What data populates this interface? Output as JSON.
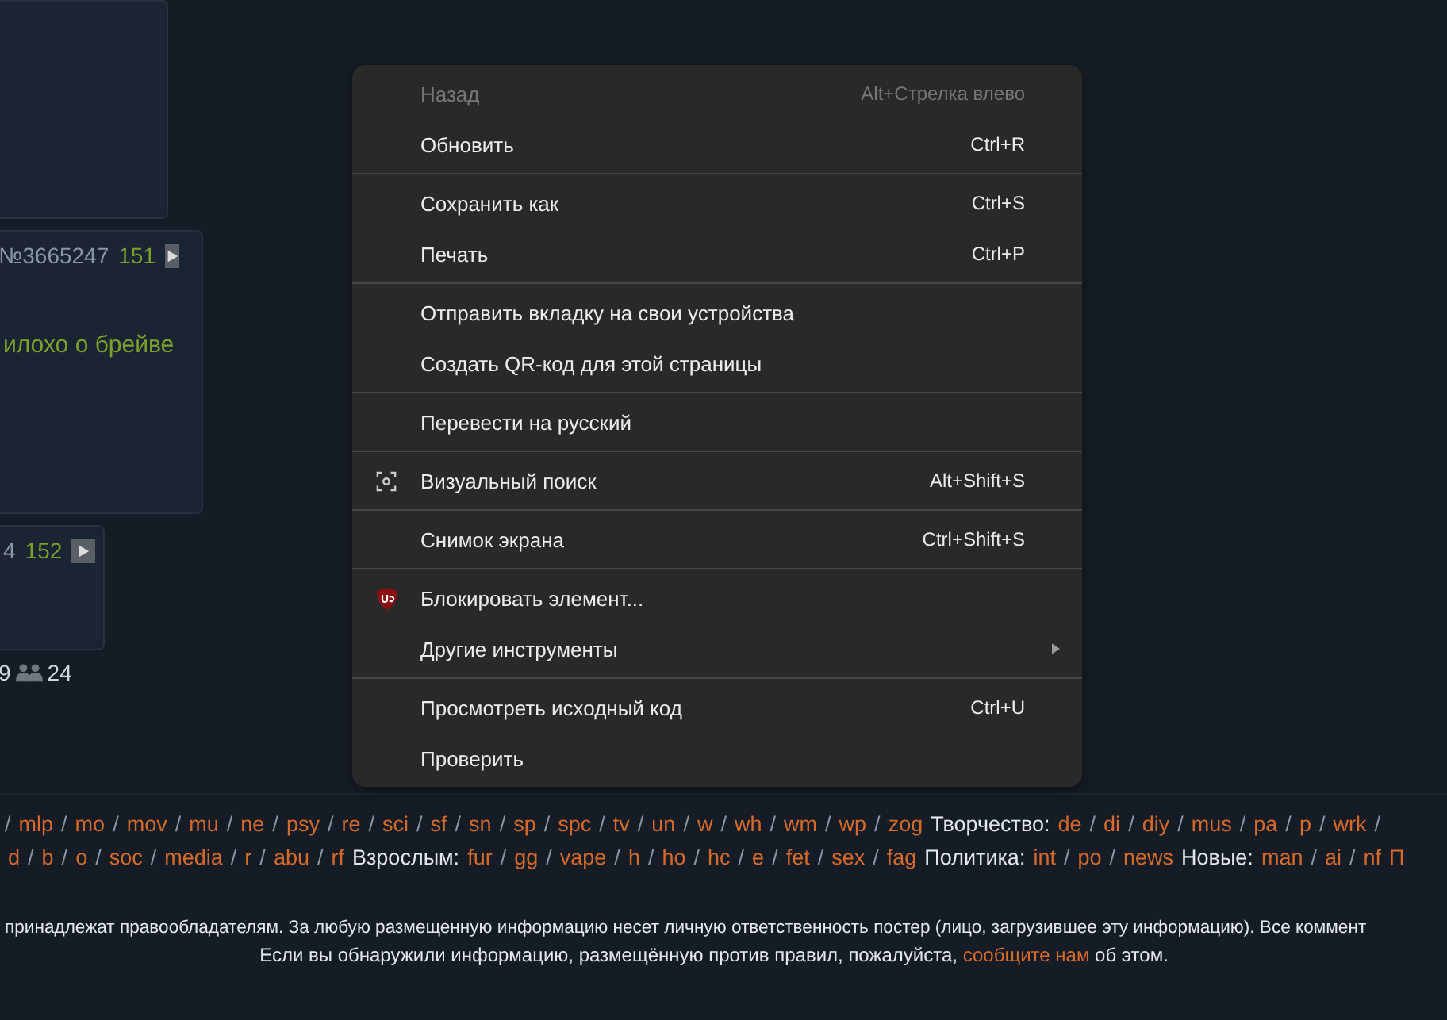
{
  "posts": [
    {
      "number": "№3665247",
      "count": "151",
      "text": "илохо о брейве"
    },
    {
      "number": "4",
      "count": "152"
    }
  ],
  "thread_stats": {
    "posts": "9",
    "users": "24"
  },
  "context_menu": {
    "sections": [
      [
        {
          "label": "Назад",
          "shortcut": "Alt+Стрелка влево",
          "kind": "plain",
          "disabled": true
        },
        {
          "label": "Обновить",
          "shortcut": "Ctrl+R",
          "kind": "plain",
          "disabled": false
        }
      ],
      [
        {
          "label": "Сохранить как",
          "shortcut": "Ctrl+S",
          "kind": "plain",
          "disabled": false
        },
        {
          "label": "Печать",
          "shortcut": "Ctrl+P",
          "kind": "plain",
          "disabled": false
        }
      ],
      [
        {
          "label": "Отправить вкладку на свои устройства",
          "kind": "plain",
          "disabled": false
        },
        {
          "label": "Создать QR-код для этой страницы",
          "kind": "plain",
          "disabled": false
        }
      ],
      [
        {
          "label": "Перевести на русский",
          "kind": "plain",
          "disabled": false
        }
      ],
      [
        {
          "label": "Визуальный поиск",
          "shortcut": "Alt+Shift+S",
          "kind": "lens",
          "disabled": false
        }
      ],
      [
        {
          "label": "Снимок экрана",
          "shortcut": "Ctrl+Shift+S",
          "kind": "plain",
          "disabled": false
        }
      ],
      [
        {
          "label": "Блокировать элемент...",
          "kind": "shield",
          "disabled": false
        },
        {
          "label": "Другие инструменты",
          "kind": "submenu",
          "disabled": false
        }
      ],
      [
        {
          "label": "Просмотреть исходный код",
          "shortcut": "Ctrl+U",
          "kind": "plain",
          "disabled": false
        },
        {
          "label": "Проверить",
          "kind": "plain",
          "disabled": false
        }
      ]
    ]
  },
  "board_links": [
    [
      {
        "kind": "sep",
        "text": "/"
      },
      {
        "kind": "link",
        "text": "mlp"
      },
      {
        "kind": "sep",
        "text": "/"
      },
      {
        "kind": "link",
        "text": "mo"
      },
      {
        "kind": "sep",
        "text": "/"
      },
      {
        "kind": "link",
        "text": "mov"
      },
      {
        "kind": "sep",
        "text": "/"
      },
      {
        "kind": "link",
        "text": "mu"
      },
      {
        "kind": "sep",
        "text": "/"
      },
      {
        "kind": "link",
        "text": "ne"
      },
      {
        "kind": "sep",
        "text": "/"
      },
      {
        "kind": "link",
        "text": "psy"
      },
      {
        "kind": "sep",
        "text": "/"
      },
      {
        "kind": "link",
        "text": "re"
      },
      {
        "kind": "sep",
        "text": "/"
      },
      {
        "kind": "link",
        "text": "sci"
      },
      {
        "kind": "sep",
        "text": "/"
      },
      {
        "kind": "link",
        "text": "sf"
      },
      {
        "kind": "sep",
        "text": "/"
      },
      {
        "kind": "link",
        "text": "sn"
      },
      {
        "kind": "sep",
        "text": "/"
      },
      {
        "kind": "link",
        "text": "sp"
      },
      {
        "kind": "sep",
        "text": "/"
      },
      {
        "kind": "link",
        "text": "spc"
      },
      {
        "kind": "sep",
        "text": "/"
      },
      {
        "kind": "link",
        "text": "tv"
      },
      {
        "kind": "sep",
        "text": "/"
      },
      {
        "kind": "link",
        "text": "un"
      },
      {
        "kind": "sep",
        "text": "/"
      },
      {
        "kind": "link",
        "text": "w"
      },
      {
        "kind": "sep",
        "text": "/"
      },
      {
        "kind": "link",
        "text": "wh"
      },
      {
        "kind": "sep",
        "text": "/"
      },
      {
        "kind": "link",
        "text": "wm"
      },
      {
        "kind": "sep",
        "text": "/"
      },
      {
        "kind": "link",
        "text": "wp"
      },
      {
        "kind": "sep",
        "text": "/"
      },
      {
        "kind": "link",
        "text": "zog"
      },
      {
        "kind": "label",
        "text": "Творчество:"
      },
      {
        "kind": "link",
        "text": "de"
      },
      {
        "kind": "sep",
        "text": "/"
      },
      {
        "kind": "link",
        "text": "di"
      },
      {
        "kind": "sep",
        "text": "/"
      },
      {
        "kind": "link",
        "text": "diy"
      },
      {
        "kind": "sep",
        "text": "/"
      },
      {
        "kind": "link",
        "text": "mus"
      },
      {
        "kind": "sep",
        "text": "/"
      },
      {
        "kind": "link",
        "text": "pa"
      },
      {
        "kind": "sep",
        "text": "/"
      },
      {
        "kind": "link",
        "text": "p"
      },
      {
        "kind": "sep",
        "text": "/"
      },
      {
        "kind": "link",
        "text": "wrk"
      },
      {
        "kind": "sep",
        "text": "/"
      }
    ],
    [
      {
        "kind": "link",
        "text": "d"
      },
      {
        "kind": "sep",
        "text": "/"
      },
      {
        "kind": "link",
        "text": "b"
      },
      {
        "kind": "sep",
        "text": "/"
      },
      {
        "kind": "link",
        "text": "o"
      },
      {
        "kind": "sep",
        "text": "/"
      },
      {
        "kind": "link",
        "text": "soc"
      },
      {
        "kind": "sep",
        "text": "/"
      },
      {
        "kind": "link",
        "text": "media"
      },
      {
        "kind": "sep",
        "text": "/"
      },
      {
        "kind": "link",
        "text": "r"
      },
      {
        "kind": "sep",
        "text": "/"
      },
      {
        "kind": "link",
        "text": "abu"
      },
      {
        "kind": "sep",
        "text": "/"
      },
      {
        "kind": "link",
        "text": "rf"
      },
      {
        "kind": "label",
        "text": "Взрослым:"
      },
      {
        "kind": "link",
        "text": "fur"
      },
      {
        "kind": "sep",
        "text": "/"
      },
      {
        "kind": "link",
        "text": "gg"
      },
      {
        "kind": "sep",
        "text": "/"
      },
      {
        "kind": "link",
        "text": "vape"
      },
      {
        "kind": "sep",
        "text": "/"
      },
      {
        "kind": "link",
        "text": "h"
      },
      {
        "kind": "sep",
        "text": "/"
      },
      {
        "kind": "link",
        "text": "ho"
      },
      {
        "kind": "sep",
        "text": "/"
      },
      {
        "kind": "link",
        "text": "hc"
      },
      {
        "kind": "sep",
        "text": "/"
      },
      {
        "kind": "link",
        "text": "e"
      },
      {
        "kind": "sep",
        "text": "/"
      },
      {
        "kind": "link",
        "text": "fet"
      },
      {
        "kind": "sep",
        "text": "/"
      },
      {
        "kind": "link",
        "text": "sex"
      },
      {
        "kind": "sep",
        "text": "/"
      },
      {
        "kind": "link",
        "text": "fag"
      },
      {
        "kind": "label",
        "text": "Политика:"
      },
      {
        "kind": "link",
        "text": "int"
      },
      {
        "kind": "sep",
        "text": "/"
      },
      {
        "kind": "link",
        "text": "po"
      },
      {
        "kind": "sep",
        "text": "/"
      },
      {
        "kind": "link",
        "text": "news"
      },
      {
        "kind": "label",
        "text": "Новые:"
      },
      {
        "kind": "link",
        "text": "man"
      },
      {
        "kind": "sep",
        "text": "/"
      },
      {
        "kind": "link",
        "text": "ai"
      },
      {
        "kind": "sep",
        "text": "/"
      },
      {
        "kind": "link",
        "text": "nf"
      },
      {
        "kind": "link",
        "text": "П"
      }
    ]
  ],
  "disclaimer": "принадлежат правообладателям. За любую размещенную информацию несет личную ответственность постер (лицо, загрузившее эту информацию). Все коммент",
  "report": {
    "before": "Если вы обнаружили информацию, размещённую против правил, пожалуйста,",
    "link": "сообщите нам",
    "after": "об этом."
  }
}
